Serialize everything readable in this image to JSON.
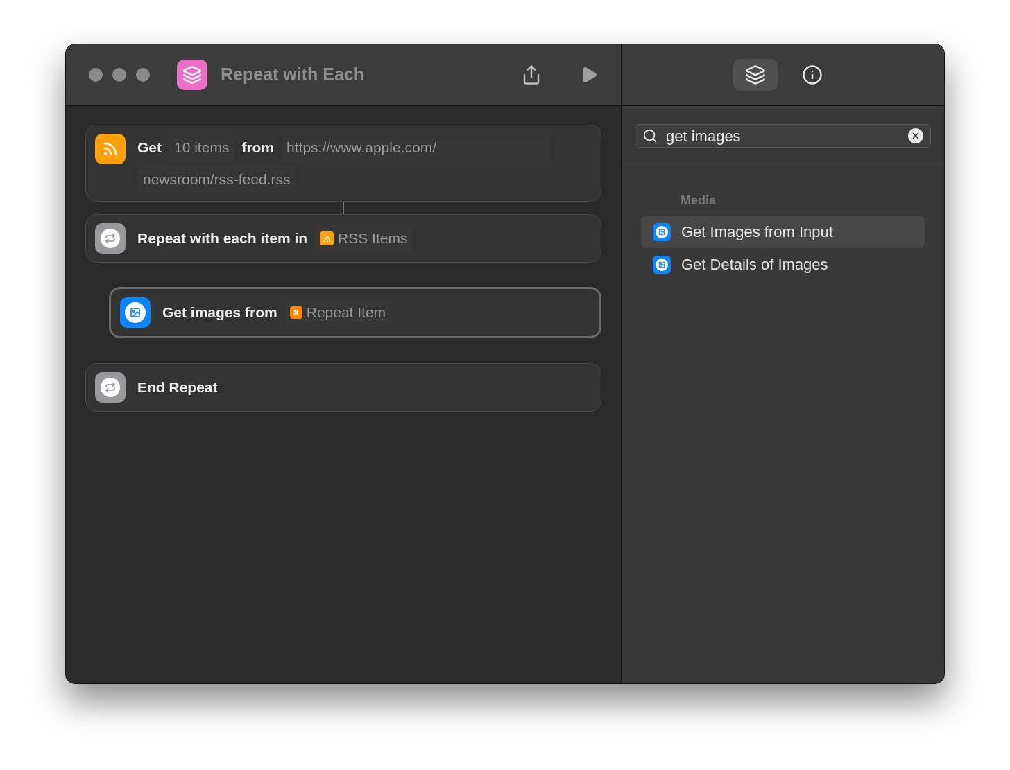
{
  "window": {
    "title": "Repeat with Each"
  },
  "actions": [
    {
      "kind": "rss",
      "selected": false,
      "parts": [
        {
          "kind": "text",
          "text": "Get"
        },
        {
          "kind": "token",
          "text": "10 items"
        },
        {
          "kind": "text",
          "text": "from"
        },
        {
          "kind": "url-token",
          "text": "https://www.apple.com/"
        },
        {
          "kind": "token",
          "text": "newsroom/rss-feed.rss"
        }
      ]
    },
    {
      "kind": "repeat",
      "selected": false,
      "parts": [
        {
          "kind": "text",
          "text": "Repeat with each item in"
        },
        {
          "kind": "rss-token",
          "text": "RSS Items"
        }
      ],
      "children": [
        {
          "kind": "images",
          "selected": true,
          "parts": [
            {
              "kind": "text",
              "text": "Get images from"
            },
            {
              "kind": "var-token",
              "text": "Repeat Item"
            }
          ]
        }
      ]
    },
    {
      "kind": "end",
      "selected": false,
      "parts": [
        {
          "kind": "text",
          "text": "End Repeat"
        }
      ]
    }
  ],
  "panel_tabs": [
    {
      "kind": "library",
      "selected": true
    },
    {
      "kind": "info",
      "selected": false
    }
  ],
  "search": {
    "value": "get images"
  },
  "results": {
    "section": "Media",
    "items": [
      {
        "label": "Get Images from Input",
        "selected": true
      },
      {
        "label": "Get Details of Images",
        "selected": false
      }
    ]
  }
}
